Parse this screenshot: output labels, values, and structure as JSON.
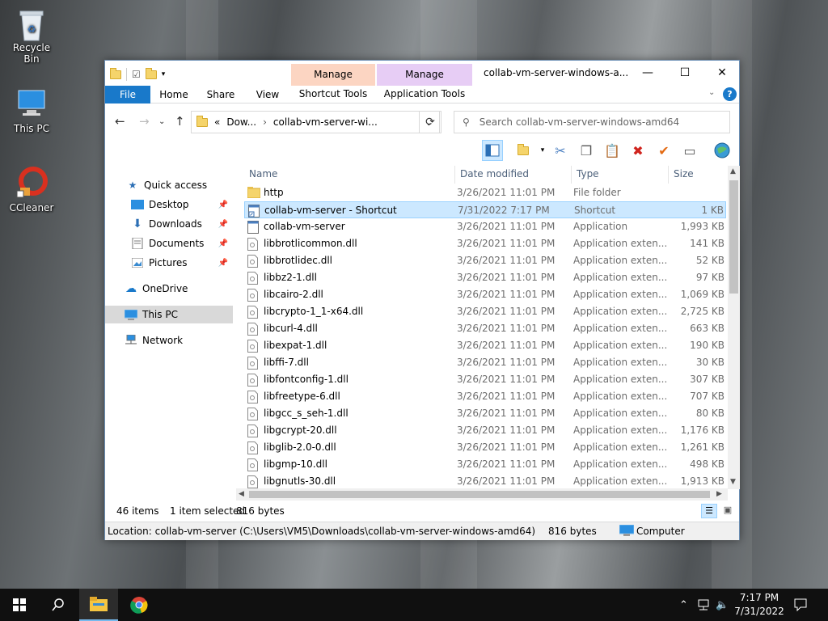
{
  "desktop": {
    "icons": [
      {
        "label": "Recycle Bin"
      },
      {
        "label": "This PC"
      },
      {
        "label": "CCleaner"
      }
    ]
  },
  "window": {
    "title": "collab-vm-server-windows-a...",
    "context_tabs": [
      {
        "group": "Manage",
        "tab": "Shortcut Tools",
        "color": "#fcd5c2"
      },
      {
        "group": "Manage",
        "tab": "Application Tools",
        "color": "#e7cdf5"
      }
    ],
    "ribbon_tabs": [
      "File",
      "Home",
      "Share",
      "View"
    ],
    "address": {
      "ellipsis": "«",
      "crumb1": "Dow...",
      "crumb2": "collab-vm-server-wi..."
    },
    "search_placeholder": "Search collab-vm-server-windows-amd64",
    "controls": {
      "minimize": "—",
      "maximize": "☐",
      "close": "✕"
    }
  },
  "nav": {
    "items": [
      {
        "label": "Quick access"
      },
      {
        "label": "Desktop",
        "pinned": true
      },
      {
        "label": "Downloads",
        "pinned": true
      },
      {
        "label": "Documents",
        "pinned": true
      },
      {
        "label": "Pictures",
        "pinned": true
      },
      {
        "label": "OneDrive"
      },
      {
        "label": "This PC",
        "selected": true
      },
      {
        "label": "Network"
      }
    ]
  },
  "columns": {
    "name": "Name",
    "date": "Date modified",
    "type": "Type",
    "size": "Size"
  },
  "files": [
    {
      "name": "http",
      "date": "3/26/2021 11:01 PM",
      "type": "File folder",
      "size": "",
      "icon": "folder"
    },
    {
      "name": "collab-vm-server - Shortcut",
      "date": "7/31/2022 7:17 PM",
      "type": "Shortcut",
      "size": "1 KB",
      "icon": "shortcut",
      "selected": true
    },
    {
      "name": "collab-vm-server",
      "date": "3/26/2021 11:01 PM",
      "type": "Application",
      "size": "1,993 KB",
      "icon": "app"
    },
    {
      "name": "libbrotlicommon.dll",
      "date": "3/26/2021 11:01 PM",
      "type": "Application exten...",
      "size": "141 KB",
      "icon": "dll"
    },
    {
      "name": "libbrotlidec.dll",
      "date": "3/26/2021 11:01 PM",
      "type": "Application exten...",
      "size": "52 KB",
      "icon": "dll"
    },
    {
      "name": "libbz2-1.dll",
      "date": "3/26/2021 11:01 PM",
      "type": "Application exten...",
      "size": "97 KB",
      "icon": "dll"
    },
    {
      "name": "libcairo-2.dll",
      "date": "3/26/2021 11:01 PM",
      "type": "Application exten...",
      "size": "1,069 KB",
      "icon": "dll"
    },
    {
      "name": "libcrypto-1_1-x64.dll",
      "date": "3/26/2021 11:01 PM",
      "type": "Application exten...",
      "size": "2,725 KB",
      "icon": "dll"
    },
    {
      "name": "libcurl-4.dll",
      "date": "3/26/2021 11:01 PM",
      "type": "Application exten...",
      "size": "663 KB",
      "icon": "dll"
    },
    {
      "name": "libexpat-1.dll",
      "date": "3/26/2021 11:01 PM",
      "type": "Application exten...",
      "size": "190 KB",
      "icon": "dll"
    },
    {
      "name": "libffi-7.dll",
      "date": "3/26/2021 11:01 PM",
      "type": "Application exten...",
      "size": "30 KB",
      "icon": "dll"
    },
    {
      "name": "libfontconfig-1.dll",
      "date": "3/26/2021 11:01 PM",
      "type": "Application exten...",
      "size": "307 KB",
      "icon": "dll"
    },
    {
      "name": "libfreetype-6.dll",
      "date": "3/26/2021 11:01 PM",
      "type": "Application exten...",
      "size": "707 KB",
      "icon": "dll"
    },
    {
      "name": "libgcc_s_seh-1.dll",
      "date": "3/26/2021 11:01 PM",
      "type": "Application exten...",
      "size": "80 KB",
      "icon": "dll"
    },
    {
      "name": "libgcrypt-20.dll",
      "date": "3/26/2021 11:01 PM",
      "type": "Application exten...",
      "size": "1,176 KB",
      "icon": "dll"
    },
    {
      "name": "libglib-2.0-0.dll",
      "date": "3/26/2021 11:01 PM",
      "type": "Application exten...",
      "size": "1,261 KB",
      "icon": "dll"
    },
    {
      "name": "libgmp-10.dll",
      "date": "3/26/2021 11:01 PM",
      "type": "Application exten...",
      "size": "498 KB",
      "icon": "dll"
    },
    {
      "name": "libgnutls-30.dll",
      "date": "3/26/2021 11:01 PM",
      "type": "Application exten...",
      "size": "1,913 KB",
      "icon": "dll"
    }
  ],
  "status": {
    "count": "46 items",
    "selected": "1 item selected",
    "size": "816 bytes"
  },
  "location": {
    "path": "Location: collab-vm-server (C:\\Users\\VM5\\Downloads\\collab-vm-server-windows-amd64)",
    "size": "816 bytes",
    "computer": "Computer"
  },
  "taskbar": {
    "time": "7:17 PM",
    "date": "7/31/2022"
  },
  "colors": {
    "accent": "#1979ca",
    "selection": "#cce8ff",
    "taskbar": "#101010"
  }
}
